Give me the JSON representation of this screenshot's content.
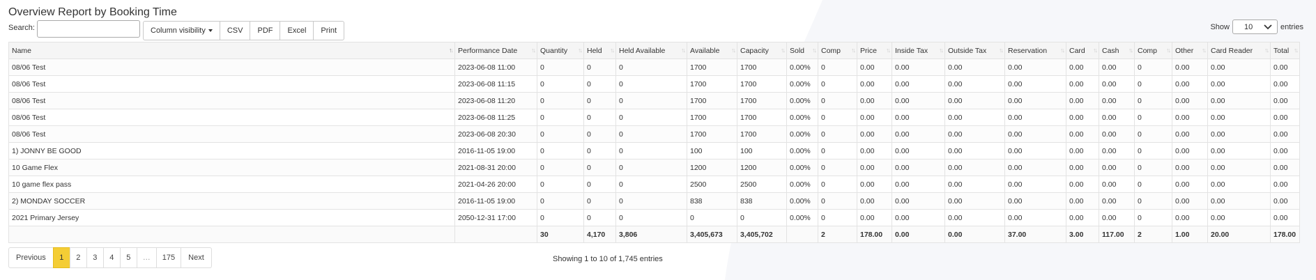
{
  "page_title": "Overview Report by Booking Time",
  "search": {
    "label": "Search:",
    "value": "",
    "placeholder": ""
  },
  "buttons": {
    "column_visibility": "Column visibility",
    "csv": "CSV",
    "pdf": "PDF",
    "excel": "Excel",
    "print": "Print"
  },
  "length_menu": {
    "show_label": "Show",
    "selected": "10",
    "entries_label": "entries"
  },
  "table": {
    "headers": [
      "Name",
      "Performance Date",
      "Quantity",
      "Held",
      "Held Available",
      "Available",
      "Capacity",
      "Sold",
      "Comp",
      "Price",
      "Inside Tax",
      "Outside Tax",
      "Reservation",
      "Card",
      "Cash",
      "Comp",
      "Other",
      "Card Reader",
      "Total"
    ],
    "rows": [
      [
        "08/06 Test",
        "2023-06-08 11:00",
        "0",
        "0",
        "0",
        "1700",
        "1700",
        "0.00%",
        "0",
        "0.00",
        "0.00",
        "0.00",
        "0.00",
        "0.00",
        "0.00",
        "0",
        "0.00",
        "0.00",
        "0.00"
      ],
      [
        "08/06 Test",
        "2023-06-08 11:15",
        "0",
        "0",
        "0",
        "1700",
        "1700",
        "0.00%",
        "0",
        "0.00",
        "0.00",
        "0.00",
        "0.00",
        "0.00",
        "0.00",
        "0",
        "0.00",
        "0.00",
        "0.00"
      ],
      [
        "08/06 Test",
        "2023-06-08 11:20",
        "0",
        "0",
        "0",
        "1700",
        "1700",
        "0.00%",
        "0",
        "0.00",
        "0.00",
        "0.00",
        "0.00",
        "0.00",
        "0.00",
        "0",
        "0.00",
        "0.00",
        "0.00"
      ],
      [
        "08/06 Test",
        "2023-06-08 11:25",
        "0",
        "0",
        "0",
        "1700",
        "1700",
        "0.00%",
        "0",
        "0.00",
        "0.00",
        "0.00",
        "0.00",
        "0.00",
        "0.00",
        "0",
        "0.00",
        "0.00",
        "0.00"
      ],
      [
        "08/06 Test",
        "2023-06-08 20:30",
        "0",
        "0",
        "0",
        "1700",
        "1700",
        "0.00%",
        "0",
        "0.00",
        "0.00",
        "0.00",
        "0.00",
        "0.00",
        "0.00",
        "0",
        "0.00",
        "0.00",
        "0.00"
      ],
      [
        "1) JONNY BE GOOD",
        "2016-11-05 19:00",
        "0",
        "0",
        "0",
        "100",
        "100",
        "0.00%",
        "0",
        "0.00",
        "0.00",
        "0.00",
        "0.00",
        "0.00",
        "0.00",
        "0",
        "0.00",
        "0.00",
        "0.00"
      ],
      [
        "10 Game Flex",
        "2021-08-31 20:00",
        "0",
        "0",
        "0",
        "1200",
        "1200",
        "0.00%",
        "0",
        "0.00",
        "0.00",
        "0.00",
        "0.00",
        "0.00",
        "0.00",
        "0",
        "0.00",
        "0.00",
        "0.00"
      ],
      [
        "10 game flex pass",
        "2021-04-26 20:00",
        "0",
        "0",
        "0",
        "2500",
        "2500",
        "0.00%",
        "0",
        "0.00",
        "0.00",
        "0.00",
        "0.00",
        "0.00",
        "0.00",
        "0",
        "0.00",
        "0.00",
        "0.00"
      ],
      [
        "2) MONDAY SOCCER",
        "2016-11-05 19:00",
        "0",
        "0",
        "0",
        "838",
        "838",
        "0.00%",
        "0",
        "0.00",
        "0.00",
        "0.00",
        "0.00",
        "0.00",
        "0.00",
        "0",
        "0.00",
        "0.00",
        "0.00"
      ],
      [
        "2021 Primary Jersey",
        "2050-12-31 17:00",
        "0",
        "0",
        "0",
        "0",
        "0",
        "0.00%",
        "0",
        "0.00",
        "0.00",
        "0.00",
        "0.00",
        "0.00",
        "0.00",
        "0",
        "0.00",
        "0.00",
        "0.00"
      ]
    ],
    "totals": [
      "",
      "",
      "30",
      "4,170",
      "3,806",
      "3,405,673",
      "3,405,702",
      "",
      "2",
      "178.00",
      "0.00",
      "0.00",
      "37.00",
      "3.00",
      "117.00",
      "2",
      "1.00",
      "20.00",
      "178.00"
    ],
    "sorted_column": "Name"
  },
  "pagination": {
    "previous": "Previous",
    "pages": [
      "1",
      "2",
      "3",
      "4",
      "5",
      "…",
      "175"
    ],
    "active_page": "1",
    "next": "Next"
  },
  "info": "Showing 1 to 10 of 1,745 entries",
  "colors": {
    "active_page": "#f4cd35",
    "header_bg": "#f5f5f5",
    "border": "#e3e3e3"
  }
}
